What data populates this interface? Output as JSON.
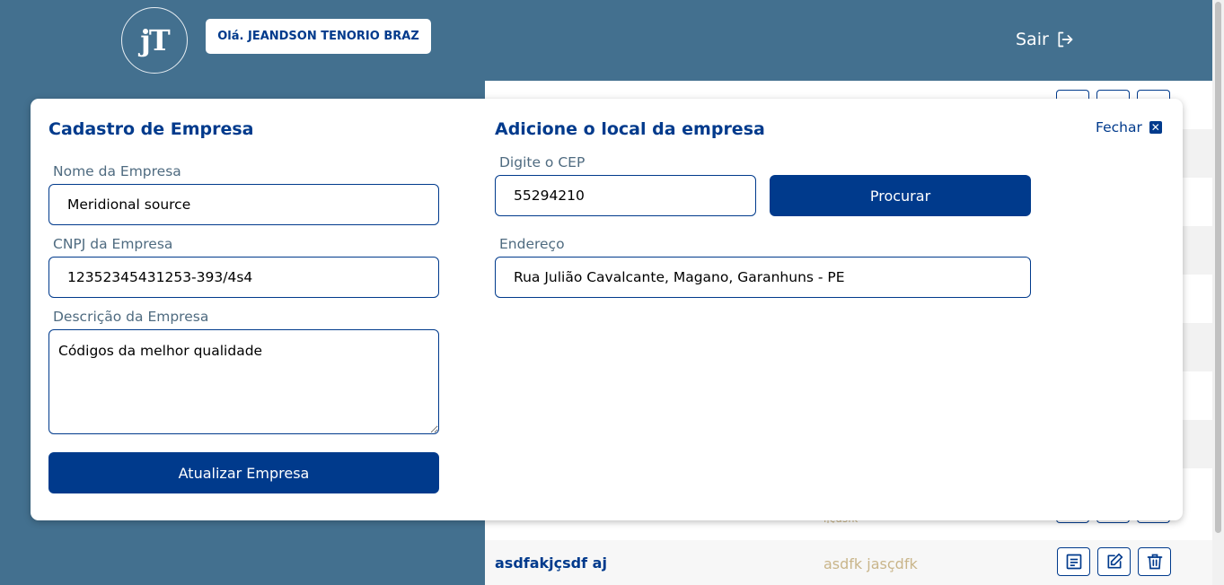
{
  "header": {
    "logo_text": "jT",
    "greeting": "Olá. JEANDSON TENORIO BRAZ",
    "logout_label": "Sair"
  },
  "table": {
    "last_row": {
      "name": "asdfakjçsdf aj",
      "description": "asdfk jasçdfk"
    },
    "partial_text": "ijçdsfk"
  },
  "modal": {
    "left_title": "Cadastro de Empresa",
    "right_title": "Adicione o local da empresa",
    "close_label": "Fechar",
    "company_name_label": "Nome da Empresa",
    "company_name_value": "Meridional source",
    "cnpj_label": "CNPJ da Empresa",
    "cnpj_value": "12352345431253-393/4s4",
    "description_label": "Descrição da Empresa",
    "description_value": "Códigos da melhor qualidade",
    "update_button": "Atualizar Empresa",
    "cep_label": "Digite o CEP",
    "cep_value": "55294210",
    "search_button": "Procurar",
    "address_label": "Endereço",
    "address_value": "Rua Julião Cavalcante, Magano, Garanhuns - PE"
  },
  "colors": {
    "background": "#43708f",
    "primary": "#003a8c",
    "muted_text": "#c9b58a"
  }
}
